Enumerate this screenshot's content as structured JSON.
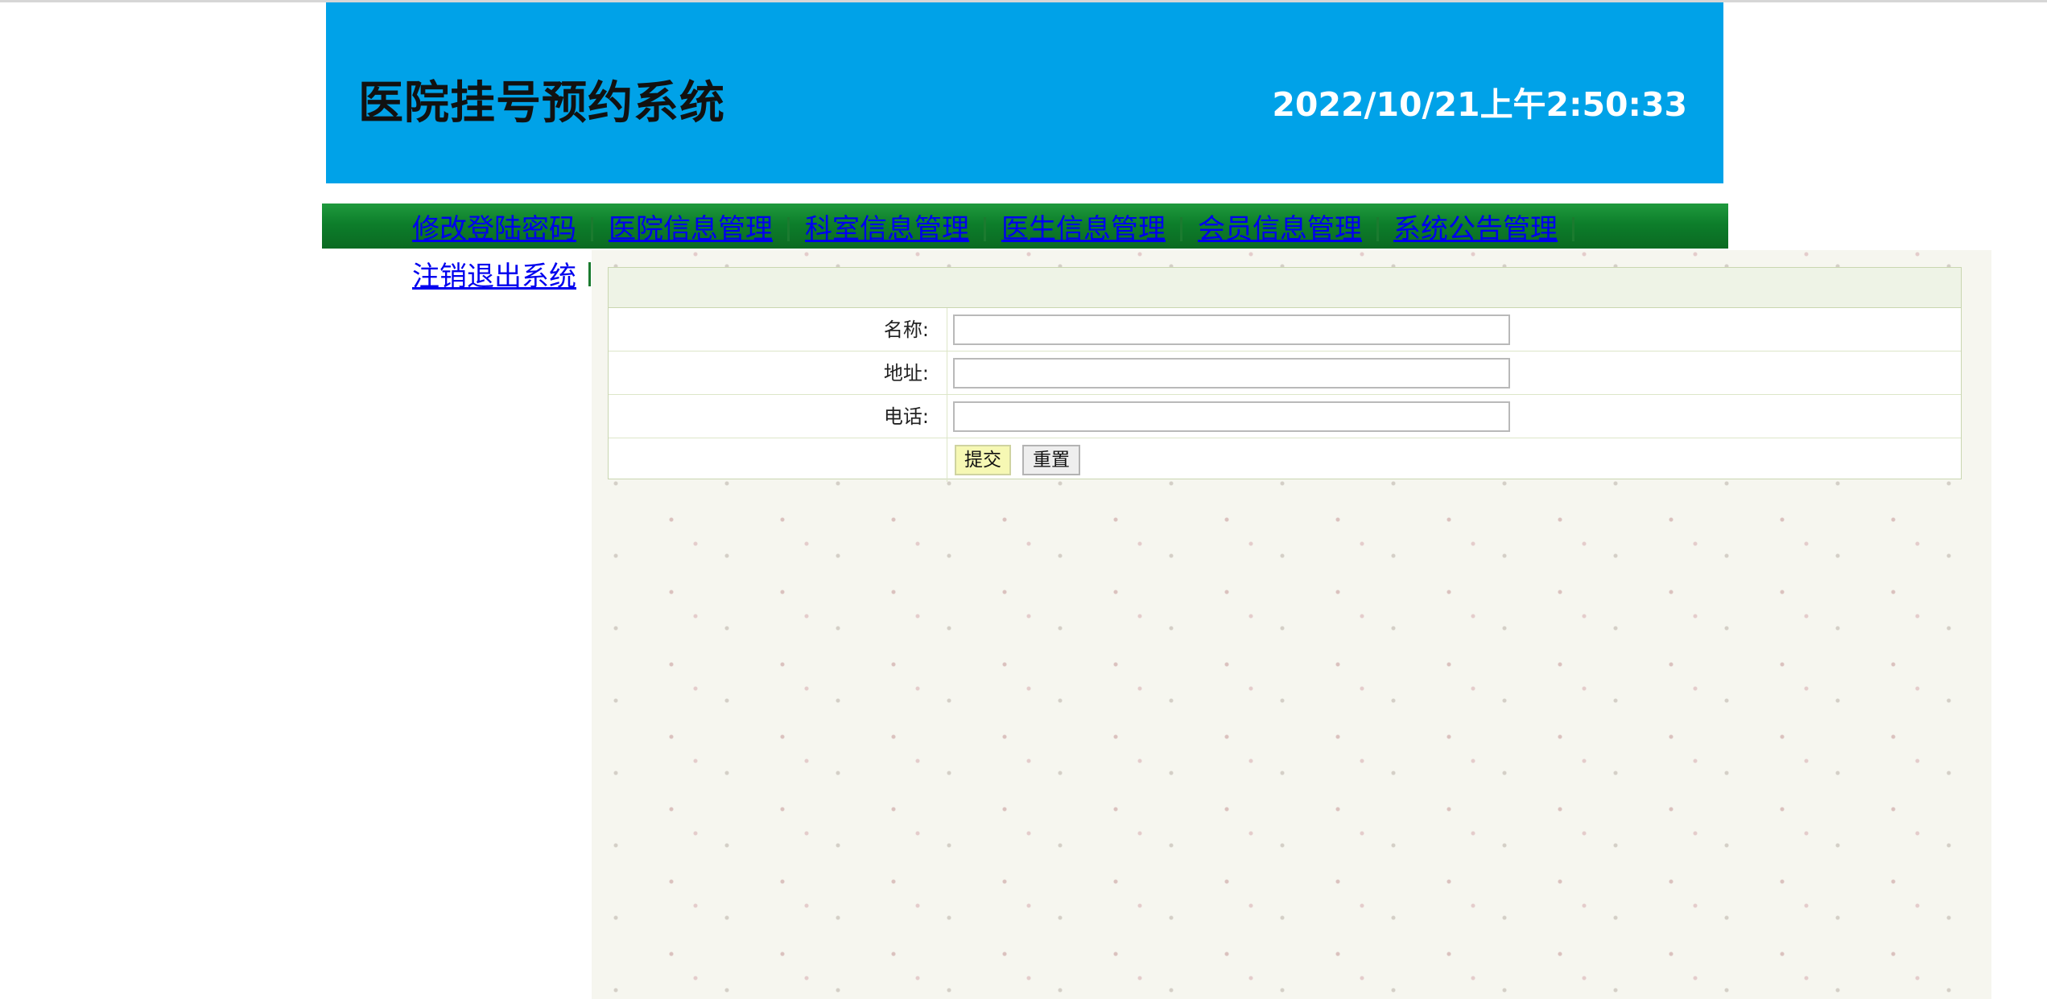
{
  "header": {
    "title": "医院挂号预约系统",
    "datetime": "2022/10/21上午2:50:33"
  },
  "nav": {
    "items": [
      {
        "label": "修改登陆密码"
      },
      {
        "label": "医院信息管理"
      },
      {
        "label": "科室信息管理"
      },
      {
        "label": "医生信息管理"
      },
      {
        "label": "会员信息管理"
      },
      {
        "label": "系统公告管理"
      },
      {
        "label": "注销退出系统"
      }
    ]
  },
  "form": {
    "fields": [
      {
        "label": "名称:",
        "value": ""
      },
      {
        "label": "地址:",
        "value": ""
      },
      {
        "label": "电话:",
        "value": ""
      }
    ],
    "submit_label": "提交",
    "reset_label": "重置"
  },
  "colors": {
    "header_bg": "#00a2e8",
    "nav_bg": "#0d7e2b",
    "link": "#0000ee"
  }
}
